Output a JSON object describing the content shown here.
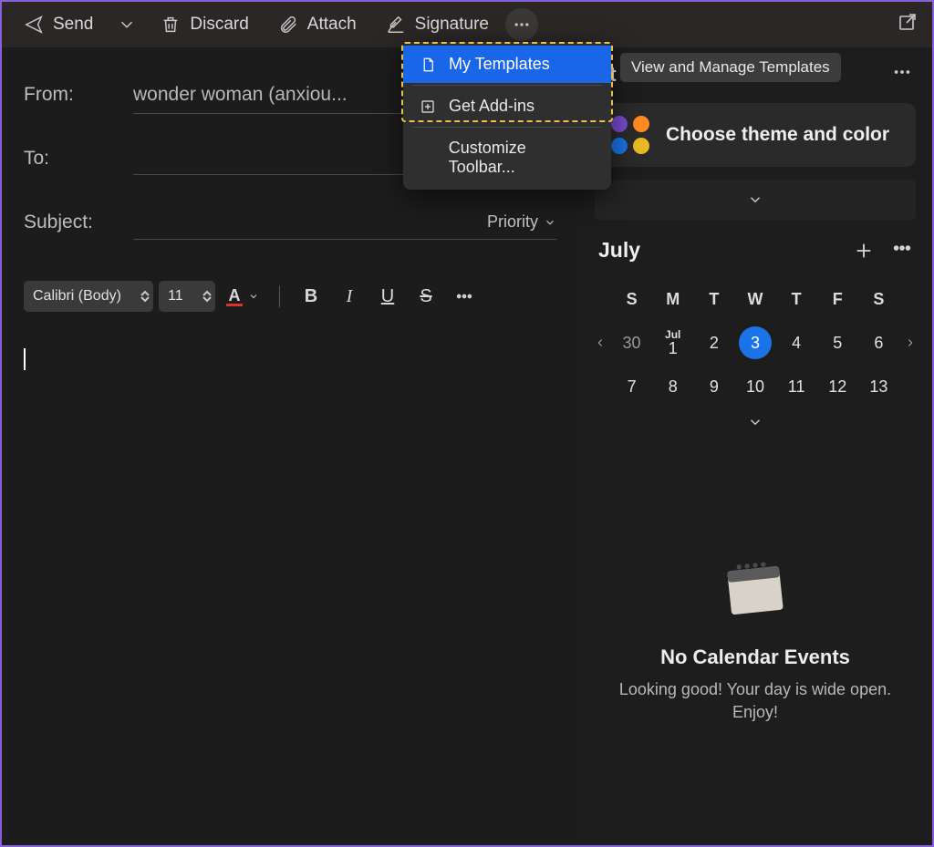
{
  "toolbar": {
    "send": "Send",
    "discard": "Discard",
    "attach": "Attach",
    "signature": "Signature"
  },
  "popup": {
    "my_templates": "My Templates",
    "get_addins": "Get Add-ins",
    "customize": "Customize Toolbar..."
  },
  "tooltip": "View and Manage Templates",
  "compose": {
    "from_label": "From:",
    "from_value": "wonder woman (anxiou...",
    "to_label": "To:",
    "to_value": "",
    "subject_label": "Subject:",
    "subject_value": "",
    "priority_label": "Priority"
  },
  "format": {
    "font": "Calibri (Body)",
    "size": "11"
  },
  "side": {
    "header_title": "et started with Outlook",
    "theme_title": "Choose theme and color",
    "theme_colors": [
      "#7a4bd0",
      "#ff8a1f",
      "#1a74e8",
      "#e8b923"
    ]
  },
  "calendar": {
    "month": "July",
    "month_short": "Jul",
    "dow": [
      "S",
      "M",
      "T",
      "W",
      "T",
      "F",
      "S"
    ],
    "week1": [
      "30",
      "1",
      "2",
      "3",
      "4",
      "5",
      "6"
    ],
    "week2": [
      "7",
      "8",
      "9",
      "10",
      "11",
      "12",
      "13"
    ],
    "selected": "3",
    "no_events_title": "No Calendar Events",
    "no_events_sub": "Looking good! Your day is wide open. Enjoy!"
  }
}
